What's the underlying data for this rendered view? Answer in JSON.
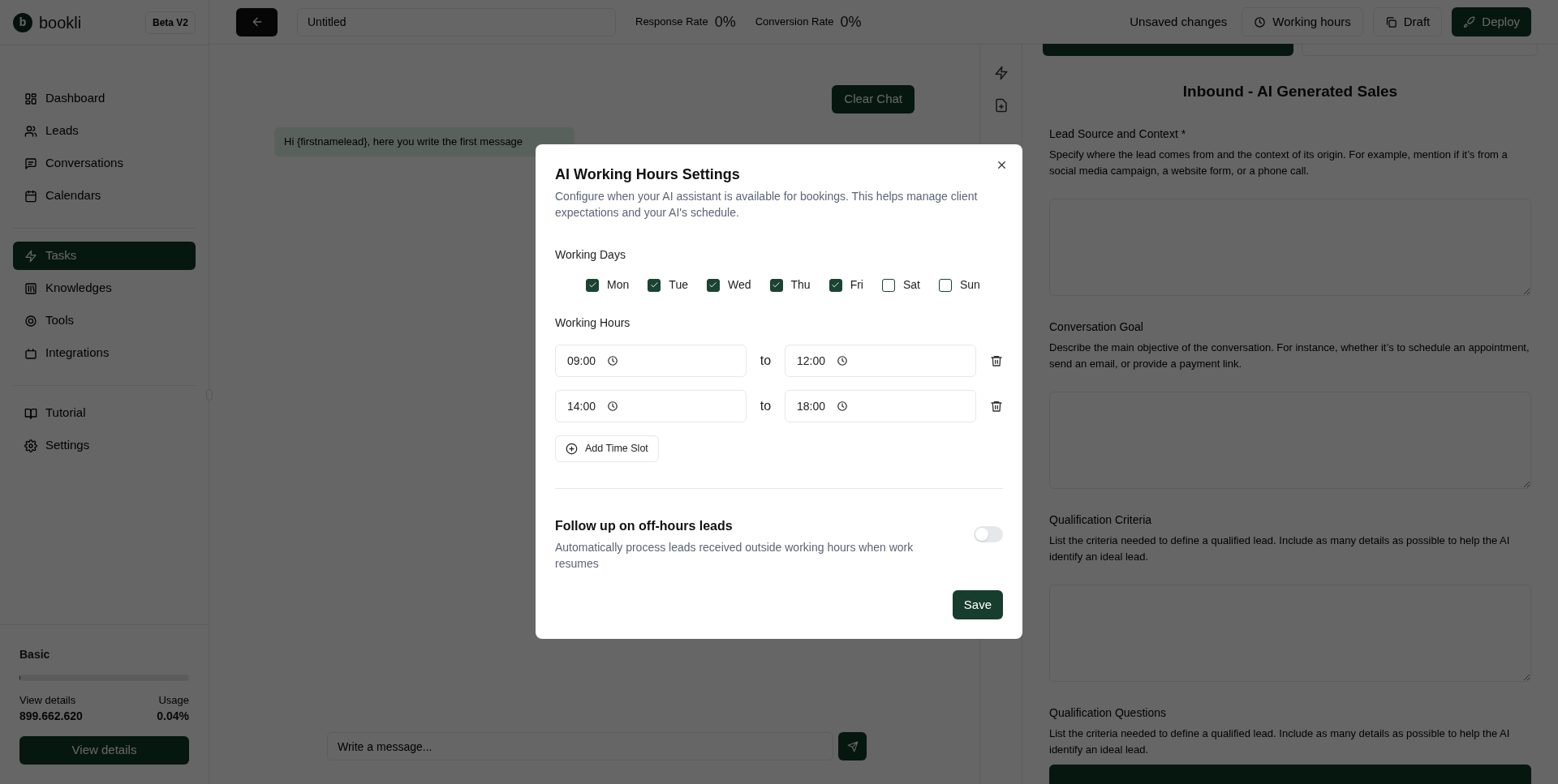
{
  "sidebar": {
    "logo_letter": "b",
    "brand": "bookli",
    "badge": "Beta V2",
    "groups": [
      [
        {
          "label": "Dashboard",
          "selected": false
        },
        {
          "label": "Leads",
          "selected": false
        },
        {
          "label": "Conversations",
          "selected": false
        },
        {
          "label": "Calendars",
          "selected": false
        }
      ],
      [
        {
          "label": "Tasks",
          "selected": true
        },
        {
          "label": "Knowledges",
          "selected": false
        },
        {
          "label": "Tools",
          "selected": false
        },
        {
          "label": "Integrations",
          "selected": false
        }
      ],
      [
        {
          "label": "Tutorial",
          "selected": false
        },
        {
          "label": "Settings",
          "selected": false
        }
      ]
    ],
    "plan": {
      "name": "Basic",
      "level": 0.0004,
      "details_label": "View details",
      "count": "899.662.620",
      "usage_label": "Usage",
      "usage": "0.04%",
      "button": "View details"
    }
  },
  "toolbar": {
    "title_value": "Untitled",
    "metrics": [
      {
        "label": "Response Rate",
        "value": "0%"
      },
      {
        "label": "Conversion Rate",
        "value": "0%"
      }
    ],
    "status": "Unsaved changes",
    "buttons": [
      {
        "kind": "outline",
        "label": "Working hours"
      },
      {
        "kind": "outline",
        "label": "Draft"
      },
      {
        "kind": "primary",
        "label": "Deploy"
      }
    ]
  },
  "chat": {
    "clear_button": "Clear Chat",
    "messages": [
      "Hi {firstnamelead}, here you write the first message"
    ],
    "input_placeholder": "Write a message..."
  },
  "form": {
    "title": "Inbound - AI Generated Sales",
    "sections": [
      {
        "label": "Lead Source and Context *",
        "help": "Specify where the lead comes from and the context of its origin. For example, mention if it’s from a social media campaign, a website form, or a phone call.",
        "kind": "textarea"
      },
      {
        "label": "Conversation Goal",
        "help": "Describe the main objective of the conversation. For instance, whether it’s to schedule an appointment, send an email, or provide a payment link.",
        "kind": "textarea"
      },
      {
        "label": "Qualification Criteria",
        "help": "List the criteria needed to define a qualified lead. Include as many details as possible to help the AI identify an ideal lead.",
        "kind": "textarea"
      },
      {
        "label": "Qualification Questions",
        "help": "List the criteria needed to define a qualified lead. Include as many details as possible to help the AI identify an ideal lead.",
        "kind": "button"
      }
    ]
  },
  "dialog": {
    "title": "AI Working Hours Settings",
    "description": "Configure when your AI assistant is available for bookings. This helps manage client expectations and your AI's schedule.",
    "days_label": "Working Days",
    "days": [
      {
        "label": "Mon",
        "checked": true
      },
      {
        "label": "Tue",
        "checked": true
      },
      {
        "label": "Wed",
        "checked": true
      },
      {
        "label": "Thu",
        "checked": true
      },
      {
        "label": "Fri",
        "checked": true
      },
      {
        "label": "Sat",
        "checked": false
      },
      {
        "label": "Sun",
        "checked": false
      }
    ],
    "hours_label": "Working Hours",
    "slots": [
      {
        "from": "09:00",
        "separator": "to",
        "to": "12:00"
      },
      {
        "from": "14:00",
        "separator": "to",
        "to": "18:00"
      }
    ],
    "add_button": "Add Time Slot",
    "followup": {
      "title": "Follow up on off-hours leads",
      "description": "Automatically process leads received outside working hours when work resumes",
      "on": false
    },
    "save_button": "Save"
  }
}
